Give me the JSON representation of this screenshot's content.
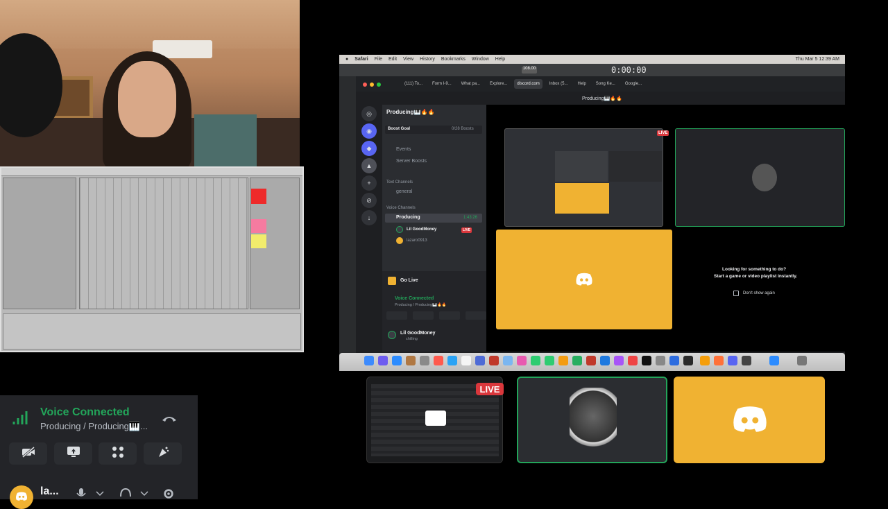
{
  "voice": {
    "title": "Voice Connected",
    "channel": "Producing / Producing🎹..."
  },
  "user": {
    "name": "la...",
    "avatar_color": "#f0b232"
  },
  "controls": [
    "camera-off-icon",
    "screen-share-icon",
    "activities-icon",
    "soundboard-icon"
  ],
  "mac": {
    "menubar": {
      "app": "Safari",
      "items": [
        "File",
        "Edit",
        "View",
        "History",
        "Bookmarks",
        "Window",
        "Help"
      ],
      "clock": "Thu Mar 5  12:39 AM"
    },
    "logic": {
      "bpm": "108.00",
      "time": "0:00:00"
    },
    "tabs": [
      "(111) To...",
      "Form I-9...",
      "What pa...",
      "Explore...",
      "discord.com",
      "Inbox (5...",
      "Help",
      "Song Ke...",
      "Google..."
    ],
    "page_title": "Producing🎹🔥🔥",
    "discord": {
      "server_name": "Producing🎹🔥🔥",
      "boost_goal": "Boost Goal",
      "boosts": "0/28 Boosts",
      "events": "Events",
      "server_boosts": "Server Boosts",
      "text_channels": "Text Channels",
      "general": "general",
      "voice_channels": "Voice Channels",
      "voice_channel": "Producing",
      "voice_timer": "1:43:26",
      "member1": "Lil GoodMoney",
      "member2": "lazaro0913",
      "live": "LIVE",
      "go_live": "Go Live",
      "vc_title": "Voice Connected",
      "vc_sub": "Producing / Producing🎹🔥🔥",
      "panel_user": "Lil GoodMoney",
      "panel_status": "chilling",
      "activity_title": "Looking for something to do?",
      "activity_sub": "Start a game or video playlist instantly.",
      "dont_show": "Don't show again"
    }
  },
  "bottom": {
    "live": "LIVE"
  },
  "colors": {
    "discord_yellow": "#f0b232",
    "voice_green": "#23a55a",
    "live_red": "#da373c"
  }
}
